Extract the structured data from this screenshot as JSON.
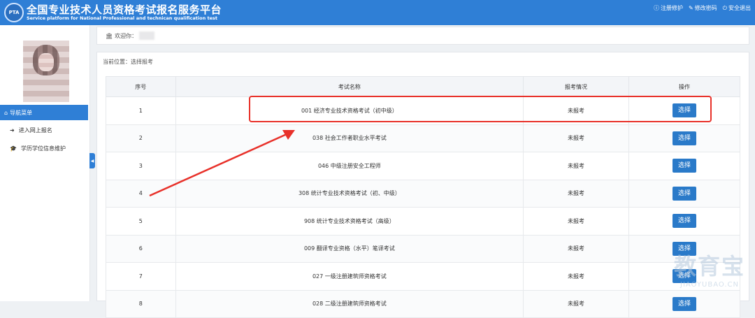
{
  "header": {
    "title": "全国专业技术人员资格考试报名服务平台",
    "subtitle": "Service platform for National Professional and technican qualification test",
    "logo_text": "PTA",
    "actions": [
      {
        "label": "注册修护",
        "icon": "info-icon"
      },
      {
        "label": "修改密码",
        "icon": "edit-icon"
      },
      {
        "label": "安全退出",
        "icon": "power-icon"
      }
    ]
  },
  "sidebar": {
    "nav_header": "导航菜单",
    "items": [
      {
        "label": "进入网上报名",
        "icon": "sign-in-icon"
      },
      {
        "label": "学历学位信息维护",
        "icon": "graduation-cap-icon"
      }
    ]
  },
  "welcome": {
    "label": "欢迎你："
  },
  "breadcrumb": "当前位置：选择报考",
  "table": {
    "headers": [
      "序号",
      "考试名称",
      "报考情况",
      "操作"
    ],
    "rows": [
      {
        "no": "1",
        "name": "001 经济专业技术资格考试（初中级）",
        "status": "未报考",
        "action": "选择"
      },
      {
        "no": "2",
        "name": "038 社会工作者职业水平考试",
        "status": "未报考",
        "action": "选择"
      },
      {
        "no": "3",
        "name": "046 中级注册安全工程师",
        "status": "未报考",
        "action": "选择"
      },
      {
        "no": "4",
        "name": "308 统计专业技术资格考试（初、中级）",
        "status": "未报考",
        "action": "选择"
      },
      {
        "no": "5",
        "name": "908 统计专业技术资格考试（高级）",
        "status": "未报考",
        "action": "选择"
      },
      {
        "no": "6",
        "name": "009 翻译专业资格（水平）笔译考试",
        "status": "未报考",
        "action": "选择"
      },
      {
        "no": "7",
        "name": "027 一级注册建筑师资格考试",
        "status": "未报考",
        "action": "选择"
      },
      {
        "no": "8",
        "name": "028 二级注册建筑师资格考试",
        "status": "未报考",
        "action": "选择"
      }
    ]
  },
  "watermark": {
    "cn": "教育宝",
    "en": "JIAOYUBAO.CN"
  },
  "colors": {
    "primary": "#2f7fd6",
    "button": "#2a7ac9",
    "highlight": "#e8312a"
  }
}
